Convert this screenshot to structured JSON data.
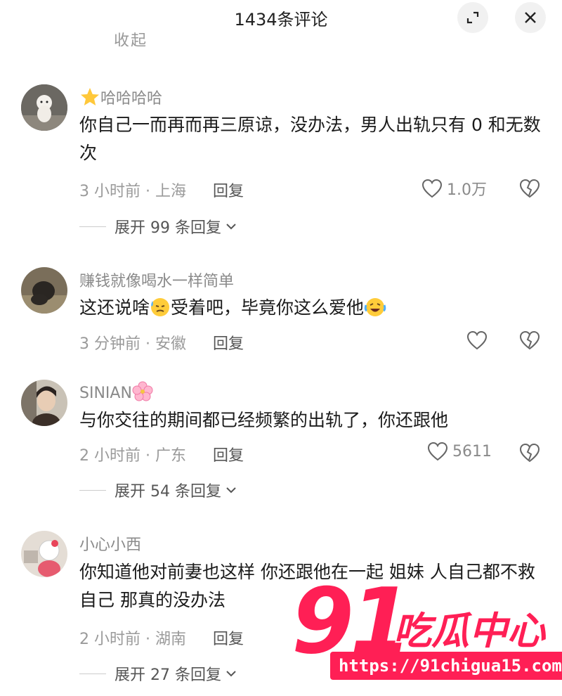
{
  "header": {
    "title": "1434条评论"
  },
  "previous_fragment": "收起",
  "comments": [
    {
      "username": "哈哈哈哈",
      "text": "你自己一而再而再三原谅，没办法，男人出轨只有 0 和无数次",
      "time": "3 小时前 · 上海",
      "reply": "回复",
      "likes": "1.0万",
      "expand": "展开 99 条回复"
    },
    {
      "username": "赚钱就像喝水一样简单",
      "text_a": "这还说啥",
      "text_b": "受着吧，毕竟你这么爱他",
      "time": "3 分钟前 · 安徽",
      "reply": "回复",
      "likes": ""
    },
    {
      "username": "SINIAN",
      "text": "与你交往的期间都已经频繁的出轨了，你还跟他",
      "time": "2 小时前 · 广东",
      "reply": "回复",
      "likes": "5611",
      "expand": "展开 54 条回复"
    },
    {
      "username": "小心小西",
      "text": "你知道他对前妻也这样 你还跟他在一起 姐妹 人自己都不救自己 那真的没办法",
      "time": "2 小时前 · 湖南",
      "reply": "回复",
      "likes": "",
      "expand": "展开 27 条回复"
    }
  ],
  "watermark": {
    "big": "91",
    "name": "吃瓜中心",
    "url": "https://91chigua15.com"
  },
  "colors": {
    "accent": "#ff1f55",
    "muted": "#9a9a9a"
  }
}
